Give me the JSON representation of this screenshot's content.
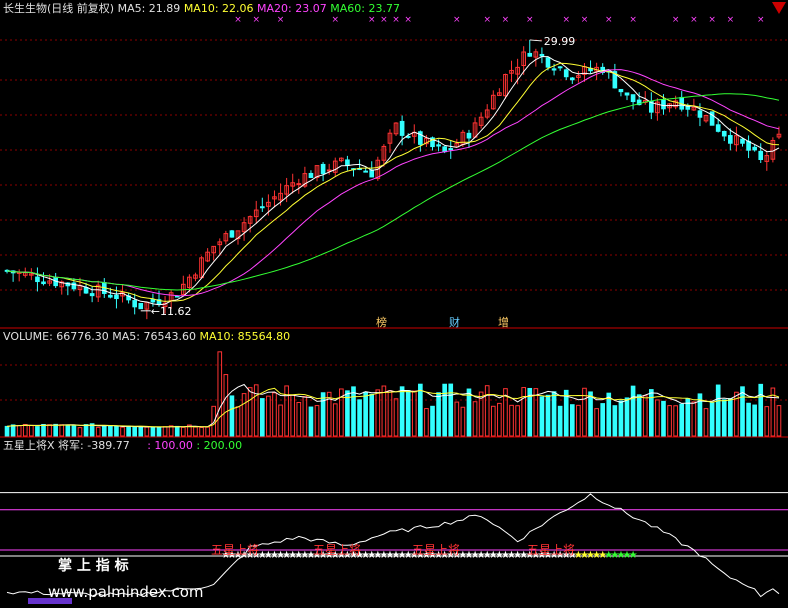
{
  "header": {
    "title": "长生生物(日线 前复权)",
    "ma5": "MA5: 21.89",
    "ma10": "MA10: 22.06",
    "ma20": "MA20: 23.07",
    "ma60": "MA60: 23.77"
  },
  "volume_header": {
    "volume": "VOLUME: 66776.30",
    "ma5": "MA5: 76543.60",
    "ma10": "MA10: 85564.80"
  },
  "indicator_header": {
    "name": "五星上将X",
    "jiangjun": "将军: -389.77",
    "l100": ": 100.00",
    "l200": ": 200.00"
  },
  "markers": {
    "m1": "榜",
    "m2": "财",
    "m3": "增"
  },
  "ribbon_labels": [
    "五星上将",
    "五星上将",
    "五星上将",
    "五星上将"
  ],
  "watermark_cn": "掌 上 指 标",
  "watermark_url": "www.palmindex.com",
  "colors": {
    "up": "#ff3333",
    "down": "#33ffff",
    "ma5": "#ffffff",
    "ma10": "#ffff33",
    "ma20": "#ff44ff",
    "ma60": "#33ff33",
    "grid": "#8b0000"
  },
  "chart_data": [
    {
      "type": "candlestick",
      "title": "长生生物(日线 前复权)",
      "annotations": [
        {
          "label": "29.99",
          "kind": "high"
        },
        {
          "label": "11.62",
          "kind": "low"
        }
      ],
      "ylim": [
        10.3,
        31.5
      ],
      "ohlc": [],
      "series": [
        {
          "name": "MA5",
          "values": []
        },
        {
          "name": "MA10",
          "values": []
        },
        {
          "name": "MA20",
          "values": []
        },
        {
          "name": "MA60",
          "values": []
        }
      ]
    },
    {
      "type": "bar",
      "title": "VOLUME",
      "ylim": [
        0,
        200000
      ],
      "values": [],
      "series": [
        {
          "name": "MA5",
          "values": []
        },
        {
          "name": "MA10",
          "values": []
        }
      ]
    },
    {
      "type": "line",
      "title": "五星上将X",
      "ylim": [
        -450,
        420
      ],
      "series": [
        {
          "name": "将军",
          "values": []
        }
      ],
      "levels": [
        100,
        200
      ]
    }
  ]
}
